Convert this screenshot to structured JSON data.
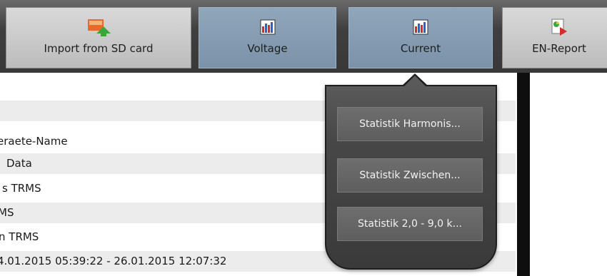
{
  "toolbar": {
    "buttons": [
      {
        "label": "Import from SD card",
        "icon": "import-sd-card-icon"
      },
      {
        "label": "Voltage",
        "icon": "bar-chart-icon"
      },
      {
        "label": "Current",
        "icon": "bar-chart-icon"
      },
      {
        "label": "EN-Report",
        "icon": "report-pdf-icon"
      }
    ]
  },
  "list": {
    "rows": [
      "",
      "",
      "eraete-Name",
      "Data",
      "s TRMS",
      "MS",
      "n TRMS",
      "4.01.2015 05:39:22 - 26.01.2015 12:07:32"
    ]
  },
  "popup": {
    "items": [
      "Statistik Harmonis...",
      "Statistik Zwischen...",
      "Statistik 2,0 - 9,0 k..."
    ]
  },
  "colors": {
    "toolbar_bg": "#3f3f3f",
    "active_button": "#7b92a8",
    "popup_bg": "#474747"
  }
}
